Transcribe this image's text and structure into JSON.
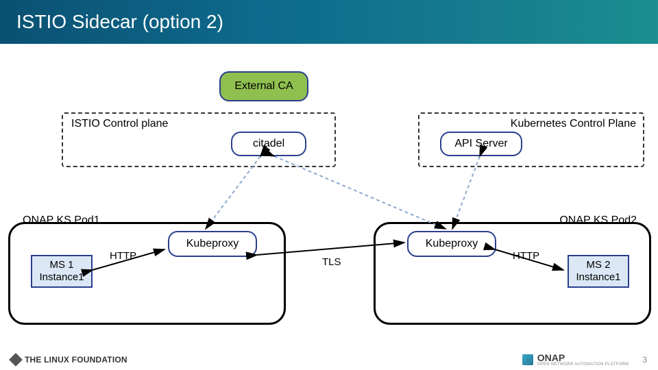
{
  "title": "ISTIO Sidecar (option 2)",
  "nodes": {
    "external_ca": "External CA",
    "citadel": "citadel",
    "api_server": "API Server"
  },
  "groups": {
    "istio_cp": "ISTIO Control plane",
    "k8s_cp": "Kubernetes Control Plane"
  },
  "pods": {
    "pod1": "ONAP KS Pod1",
    "pod2": "ONAP KS Pod2"
  },
  "services": {
    "ms1": "MS 1\nInstance1",
    "ms2": "MS 2\nInstance1",
    "kubeproxy": "Kubeproxy"
  },
  "edges": {
    "http": "HTTP",
    "tls": "TLS"
  },
  "footer": {
    "lf": "THE LINUX FOUNDATION",
    "onap_main": "ONAP",
    "onap_sub": "OPEN NETWORK AUTOMATION PLATFORM",
    "page": "3"
  }
}
